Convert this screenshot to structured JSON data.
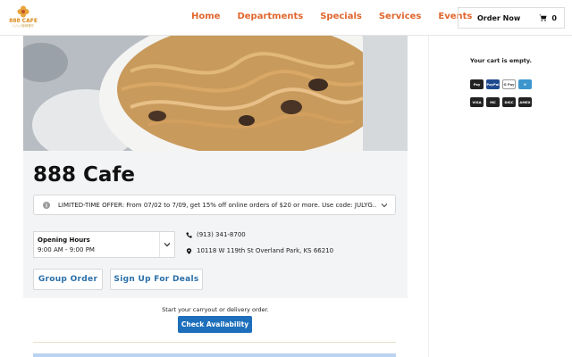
{
  "brand": {
    "name": "888 CAFE",
    "subtitle": "八八八咖啡餐厅"
  },
  "nav": {
    "items": [
      "Home",
      "Departments",
      "Specials",
      "Services",
      "Events"
    ]
  },
  "order": {
    "label": "Order Now",
    "cart_count": "0"
  },
  "restaurant": {
    "title": "888 Cafe"
  },
  "offer": {
    "text": "LIMITED-TIME OFFER: From 07/02 to 7/09, get 15% off online orders of $20 or more. Use code: JULYG..."
  },
  "hours": {
    "label": "Opening Hours",
    "value": "9:00 AM - 9:00 PM"
  },
  "contact": {
    "phone": "(913) 341-8700",
    "address": "10118 W 119th St Overland Park, KS 66210"
  },
  "buttons": {
    "group_order": "Group Order",
    "deals": "Sign Up For Deals"
  },
  "availability": {
    "prompt": "Start your carryout or delivery order.",
    "button": "Check Availability"
  },
  "cart": {
    "empty": "Your cart is empty."
  },
  "payments": {
    "apple_pay": "Pay",
    "paypal": "PayPal",
    "google_pay": "G Pay",
    "venmo": "V",
    "visa": "VISA",
    "mastercard": "MC",
    "discover": "DISC",
    "amex": "AMEX"
  },
  "colors": {
    "accent": "#e0662d",
    "link_blue": "#2a6ea8",
    "button_blue": "#1d6fbb"
  }
}
